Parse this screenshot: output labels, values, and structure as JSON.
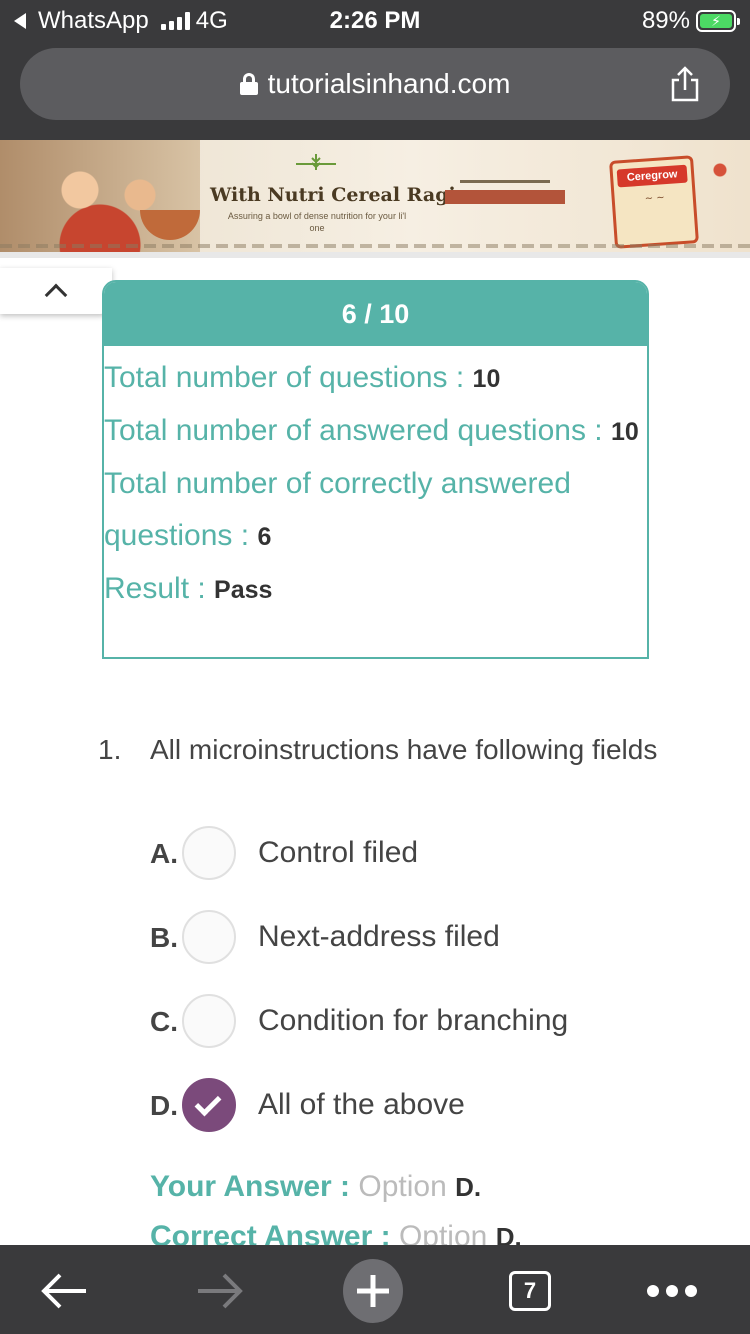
{
  "status_bar": {
    "back_app": "WhatsApp",
    "network": "4G",
    "time": "2:26 PM",
    "battery": "89%"
  },
  "browser": {
    "url": "tutorialsinhand.com"
  },
  "ad": {
    "headline": "With Nutri Cereal Ragi",
    "subline": "Assuring a bowl of dense nutrition for your li'l one",
    "brand": "Ceregrow"
  },
  "result": {
    "score": "6 / 10",
    "rows": [
      {
        "label": "Total number of questions : ",
        "value": "10"
      },
      {
        "label": "Total number of answered questions : ",
        "value": "10"
      },
      {
        "label": "Total number of correctly answered questions : ",
        "value": "6"
      },
      {
        "label": "Result : ",
        "value": "Pass"
      }
    ]
  },
  "question": {
    "number": "1.",
    "text": "All microinstructions have following fields",
    "options": [
      {
        "letter": "A.",
        "text": "Control filed",
        "selected": false
      },
      {
        "letter": "B.",
        "text": "Next-address filed",
        "selected": false
      },
      {
        "letter": "C.",
        "text": "Condition for branching",
        "selected": false
      },
      {
        "letter": "D.",
        "text": "All of the above",
        "selected": true
      }
    ],
    "your_answer": {
      "label": "Your Answer : ",
      "option_word": "Option ",
      "letter": "D."
    },
    "correct_answer": {
      "label": "Correct Answer : ",
      "option_word": "Option ",
      "letter": "D."
    }
  },
  "toolbar": {
    "tab_count": "7"
  },
  "colors": {
    "accent": "#56b3a8",
    "selected": "#7b4a7b",
    "chrome": "#3a3a3c"
  }
}
